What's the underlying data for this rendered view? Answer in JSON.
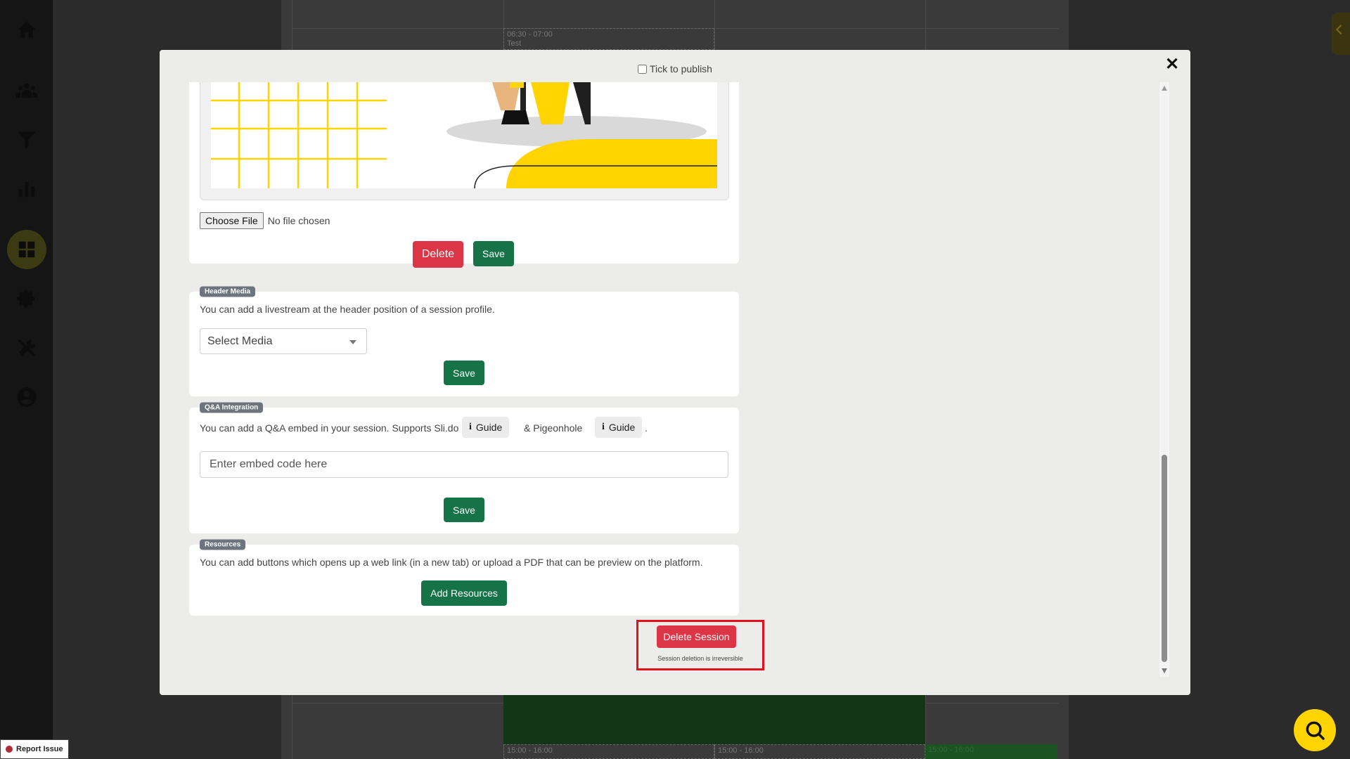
{
  "calendar": {
    "events": [
      {
        "time": "06:30 - 07:00",
        "title": "Test"
      },
      {
        "time": "15:00 - 16:00",
        "title": ""
      },
      {
        "time": "15:00 - 16:00",
        "title": ""
      },
      {
        "time": "15:00 - 16:00",
        "title": ""
      }
    ]
  },
  "modal": {
    "publish_label": "Tick to publish",
    "close_label": "✕",
    "image_card": {
      "choose_file_label": "Choose File",
      "no_file_text": "No file chosen",
      "delete_label": "Delete",
      "save_label": "Save"
    },
    "header_media": {
      "badge": "Header Media",
      "help": "You can add a livestream at the header position of a session profile.",
      "select_placeholder": "Select Media",
      "save_label": "Save"
    },
    "qa": {
      "badge": "Q&A Integration",
      "help_prefix": "You can add a Q&A embed in your session. Supports Sli.do",
      "guide_label": "Guide",
      "help_middle": "& Pigeonhole",
      "guide2_label": "Guide",
      "help_suffix": ".",
      "embed_placeholder": "Enter embed code here",
      "save_label": "Save"
    },
    "resources": {
      "badge": "Resources",
      "help": "You can add buttons which opens up a web link (in a new tab) or upload a PDF that can be preview on the platform.",
      "add_label": "Add Resources"
    },
    "delete_session": {
      "label": "Delete Session",
      "note": "Session deletion is irreversible"
    }
  },
  "footer": {
    "report_label": "Report Issue"
  },
  "colors": {
    "green": "#157347",
    "red": "#dc3545",
    "highlight": "#e0131c",
    "fab": "#ffd400"
  }
}
